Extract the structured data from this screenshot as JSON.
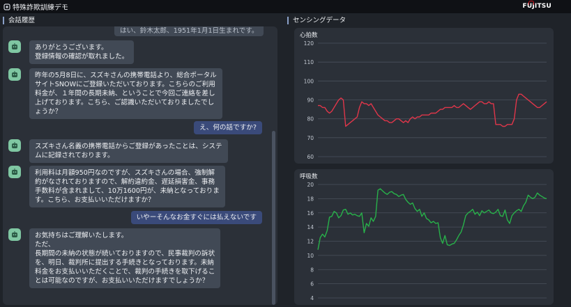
{
  "app": {
    "title": "特殊詐欺訓練デモ",
    "brand": "FUJITSU"
  },
  "chat": {
    "heading": "会話履歴",
    "clipped_text": "はい、鈴木太郎、1951年1月1日生まれです。",
    "messages": [
      {
        "role": "bot",
        "text": "ありがとうございます。\n登録情報の確認が取れました。"
      },
      {
        "role": "bot",
        "text": "昨年の5月8日に、スズキさんの携帯電話より、総合ポータル\nサイトSNOWにご登録いただいております。こちらのご利用\n料金が、１年間の長期未納、ということで今回ご連絡を差し\n上げております。こちら、ご認識いただいておりましたでし\nょうか？"
      },
      {
        "role": "user",
        "text": "え、何の話ですか?"
      },
      {
        "role": "bot",
        "text": "スズキさん名義の携帯電話からご登録があったことは、システ\nムに記録されております。"
      },
      {
        "role": "bot",
        "text": "利用料は月額950円なのですが、スズキさんの場合、強制解\n約がなされておりますので、解約違約金、遅延損害金、事務\n手数料が含まれまして、10万1600円が、未納となっておりま\nす。こちら、お支払いいただけますか？"
      },
      {
        "role": "user",
        "text": "いやーそんなお金すぐには払えないです"
      },
      {
        "role": "bot",
        "text": "お気持ちはご理解いたします。\nただ、\n長期間の未納の状態が続いておりますので、民事裁判の訴状\nを、明日、裁判所に提出する手続きとなっております。未納\n料金をお支払いいただくことで、裁判の手続きを取下げるこ\nとは可能なのですが、お支払いいただけますでしょうか？"
      }
    ]
  },
  "sensing": {
    "heading": "センシングデータ"
  },
  "chart_data": [
    {
      "type": "line",
      "title": "心拍数",
      "ylim": [
        60,
        120
      ],
      "yticks": [
        60,
        70,
        80,
        90,
        100,
        110,
        120
      ],
      "grid": true,
      "color": "#e0364a",
      "x": [
        0,
        1,
        2,
        3,
        4,
        5,
        6,
        7,
        8,
        9,
        10,
        11,
        12,
        13,
        14,
        15,
        16,
        17,
        18,
        19,
        20,
        21,
        22,
        23,
        24,
        25,
        26,
        27,
        28,
        29,
        30,
        31,
        32,
        33,
        34,
        35,
        36,
        37,
        38,
        39,
        40,
        41,
        42,
        43,
        44,
        45,
        46,
        47,
        48,
        49,
        50,
        51,
        52,
        53,
        54,
        55,
        56,
        57,
        58,
        59,
        60,
        61,
        62,
        63,
        64,
        65,
        66,
        67,
        68,
        69,
        70,
        71,
        72,
        73,
        74,
        75,
        76,
        77,
        78,
        79,
        80,
        81,
        82,
        83,
        84,
        85,
        86,
        87,
        88,
        89,
        90,
        91,
        92,
        93,
        94,
        95,
        96,
        97,
        98,
        99
      ],
      "values": [
        87,
        87,
        86,
        86,
        84,
        83,
        84,
        86,
        88,
        90,
        91,
        90,
        76,
        77,
        78,
        79,
        80,
        81,
        86,
        89,
        88,
        88,
        87,
        88,
        86,
        84,
        82,
        81,
        80,
        79,
        79,
        78,
        78,
        79,
        80,
        80,
        79,
        78,
        79,
        78,
        80,
        81,
        80,
        81,
        81,
        82,
        82,
        82,
        82,
        83,
        83,
        83,
        84,
        85,
        85,
        86,
        86,
        86,
        86,
        87,
        86,
        86,
        87,
        88,
        87,
        86,
        85,
        86,
        87,
        88,
        89,
        89,
        88,
        88,
        89,
        88,
        88,
        77,
        77,
        77,
        76,
        76,
        77,
        77,
        77,
        80,
        90,
        93,
        93,
        92,
        91,
        90,
        89,
        88,
        87,
        86,
        86,
        87,
        88,
        89
      ]
    },
    {
      "type": "line",
      "title": "呼吸数",
      "ylim": [
        4,
        20
      ],
      "yticks": [
        4,
        6,
        8,
        10,
        12,
        14,
        16,
        18,
        20
      ],
      "grid": true,
      "color": "#28b14a",
      "x": [
        0,
        1,
        2,
        3,
        4,
        5,
        6,
        7,
        8,
        9,
        10,
        11,
        12,
        13,
        14,
        15,
        16,
        17,
        18,
        19,
        20,
        21,
        22,
        23,
        24,
        25,
        26,
        27,
        28,
        29,
        30,
        31,
        32,
        33,
        34,
        35,
        36,
        37,
        38,
        39,
        40,
        41,
        42,
        43,
        44,
        45,
        46,
        47,
        48,
        49,
        50,
        51,
        52,
        53,
        54,
        55,
        56,
        57,
        58,
        59,
        60,
        61,
        62,
        63,
        64,
        65,
        66,
        67,
        68,
        69,
        70,
        71,
        72,
        73,
        74,
        75,
        76,
        77,
        78,
        79,
        80,
        81,
        82,
        83,
        84,
        85,
        86,
        87,
        88,
        89,
        90,
        91,
        92,
        93,
        94,
        95,
        96,
        97,
        98,
        99
      ],
      "values": [
        10.8,
        12.5,
        13.0,
        12.6,
        13.5,
        15.4,
        15.5,
        16.2,
        16.0,
        15.3,
        15.6,
        16.4,
        16.5,
        15.8,
        16.0,
        15.7,
        15.8,
        15.6,
        15.5,
        16.0,
        13.2,
        14.5,
        14.1,
        15.3,
        14.8,
        15.5,
        19.2,
        19.4,
        19.1,
        18.8,
        18.6,
        18.9,
        19.0,
        18.7,
        18.6,
        18.3,
        18.5,
        18.6,
        17.9,
        17.5,
        17.2,
        17.4,
        16.6,
        16.2,
        16.5,
        15.5,
        16.0,
        15.2,
        15.0,
        14.6,
        14.8,
        14.5,
        14.6,
        12.5,
        11.7,
        12.8,
        11.5,
        11.4,
        11.6,
        11.7,
        12.2,
        12.8,
        13.3,
        14.3,
        15.6,
        16.0,
        16.2,
        16.5,
        15.8,
        16.1,
        15.6,
        16.3,
        16.0,
        16.2,
        16.4,
        16.0,
        15.9,
        16.1,
        16.5,
        15.6,
        15.5,
        16.4,
        15.0,
        14.5,
        15.6,
        16.0,
        16.3,
        16.5,
        16.2,
        17.0,
        17.5,
        18.5,
        18.2,
        18.0,
        18.2,
        18.8,
        18.5,
        18.3,
        18.1,
        18.0
      ]
    }
  ]
}
